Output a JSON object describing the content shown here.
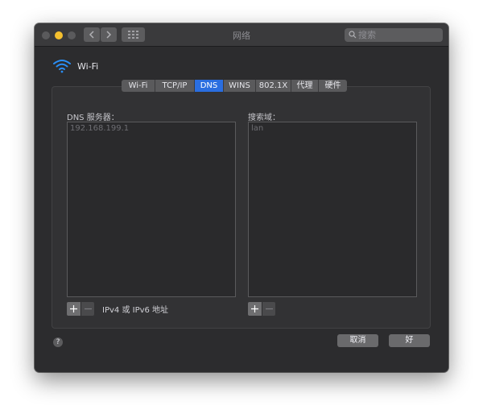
{
  "window": {
    "title": "网络",
    "search_placeholder": "搜索"
  },
  "network": {
    "service_label": "Wi-Fi"
  },
  "tabs": [
    {
      "label": "Wi-Fi",
      "active": false
    },
    {
      "label": "TCP/IP",
      "active": false
    },
    {
      "label": "DNS",
      "active": true
    },
    {
      "label": "WINS",
      "active": false
    },
    {
      "label": "802.1X",
      "active": false
    },
    {
      "label": "代理",
      "active": false
    },
    {
      "label": "硬件",
      "active": false
    }
  ],
  "dns": {
    "label": "DNS 服务器：",
    "servers": [
      "192.168.199.1"
    ],
    "hint": "IPv4 或 IPv6 地址"
  },
  "search_domains": {
    "label": "搜索域：",
    "domains": [
      "lan"
    ]
  },
  "footer": {
    "help_label": "?",
    "cancel_label": "取消",
    "ok_label": "好"
  },
  "colors": {
    "accent": "#2a6ee0",
    "window_bg": "#2c2c2e",
    "minimize_yellow": "#f4bf2e"
  },
  "icons": [
    "chevron-left-icon",
    "chevron-right-icon",
    "grid-icon",
    "search-icon",
    "wifi-icon",
    "plus-icon",
    "minus-icon",
    "help-icon"
  ]
}
